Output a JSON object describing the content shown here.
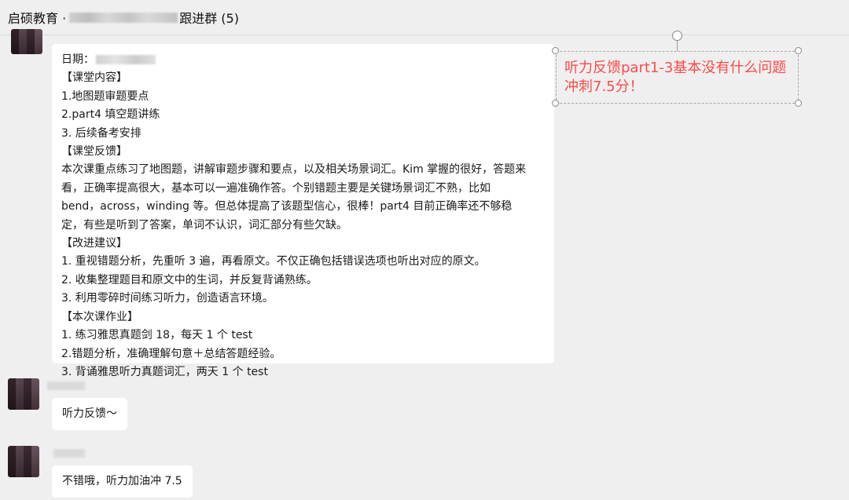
{
  "header": {
    "title_prefix": "启硕教育 · ",
    "title_suffix": "跟进群 (5)"
  },
  "messages": [
    {
      "lines": [
        "日期：",
        "【课堂内容】",
        "1.地图题审题要点",
        "2.part4 填空题讲练",
        "3. 后续备考安排",
        "【课堂反馈】",
        "本次课重点练习了地图题，讲解审题步骤和要点，以及相关场景词汇。Kim 掌握的很好，答题来",
        "看，正确率提高很大，基本可以一遍准确作答。个别错题主要是关键场景词汇不熟，比如",
        "bend，across，winding 等。但总体提高了该题型信心，很棒！part4 目前正确率还不够稳",
        "定，有些是听到了答案，单词不认识，词汇部分有些欠缺。",
        "【改进建议】",
        "1. 重视错题分析，先重听 3 遍，再看原文。不仅正确包括错误选项也听出对应的原文。",
        "2. 收集整理题目和原文中的生词，并反复背诵熟练。",
        "3. 利用零碎时间练习听力，创造语言环境。",
        "【本次课作业】",
        "1. 练习雅思真题剑 18，每天 1 个 test",
        "2.错题分析，准确理解句意＋总结答题经验。",
        "3. 背诵雅思听力真题词汇，两天 1 个 test"
      ]
    },
    {
      "text": "听力反馈～"
    },
    {
      "text": "不错哦，听力加油冲 7.5"
    }
  ],
  "annotation": {
    "line1": "听力反馈part1-3基本没有什么问题",
    "line2": "冲刺7.5分！",
    "color": "#ff4a4a"
  }
}
